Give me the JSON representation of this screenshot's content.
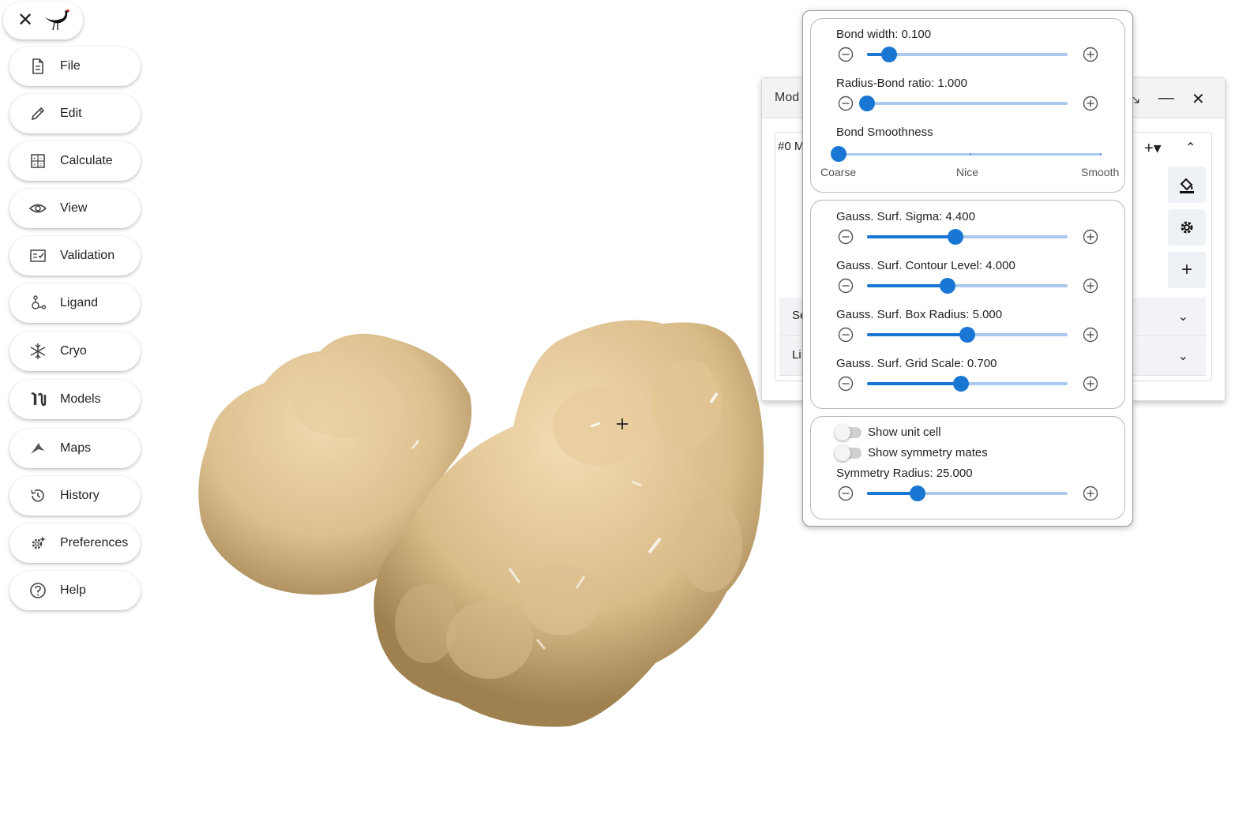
{
  "menu": [
    {
      "id": "file",
      "label": "File",
      "icon": "file-icon"
    },
    {
      "id": "edit",
      "label": "Edit",
      "icon": "pencil-icon"
    },
    {
      "id": "calculate",
      "label": "Calculate",
      "icon": "calculator-icon"
    },
    {
      "id": "view",
      "label": "View",
      "icon": "eye-icon"
    },
    {
      "id": "validation",
      "label": "Validation",
      "icon": "checklist-icon"
    },
    {
      "id": "ligand",
      "label": "Ligand",
      "icon": "molecule-icon"
    },
    {
      "id": "cryo",
      "label": "Cryo",
      "icon": "snowflake-icon"
    },
    {
      "id": "models",
      "label": "Models",
      "icon": "models-icon"
    },
    {
      "id": "maps",
      "label": "Maps",
      "icon": "map-ribbon-icon"
    },
    {
      "id": "history",
      "label": "History",
      "icon": "history-icon"
    },
    {
      "id": "preferences",
      "label": "Preferences",
      "icon": "gear-sparkle-icon"
    },
    {
      "id": "help",
      "label": "Help",
      "icon": "help-circle-icon"
    }
  ],
  "models_window": {
    "title": "Mod",
    "model_title": "#0 M",
    "accordion": [
      "Se",
      "Li"
    ]
  },
  "bond_card": {
    "bond_width": {
      "label": "Bond width: 0.100",
      "fraction": 0.11
    },
    "radius_bond": {
      "label": "Radius-Bond ratio: 1.000",
      "fraction": 0.0
    },
    "smoothness": {
      "label": "Bond Smoothness",
      "marks": [
        "Coarse",
        "Nice",
        "Smooth"
      ],
      "value_index": 0
    }
  },
  "gauss_card": [
    {
      "label": "Gauss. Surf. Sigma: 4.400",
      "fraction": 0.44
    },
    {
      "label": "Gauss. Surf. Contour Level: 4.000",
      "fraction": 0.4
    },
    {
      "label": "Gauss. Surf. Box Radius: 5.000",
      "fraction": 0.5
    },
    {
      "label": "Gauss. Surf. Grid Scale: 0.700",
      "fraction": 0.47
    }
  ],
  "symmetry_card": {
    "show_unit_cell": {
      "label": "Show unit cell",
      "on": false
    },
    "show_symmetry_mates": {
      "label": "Show symmetry mates",
      "on": false
    },
    "radius": {
      "label": "Symmetry Radius: 25.000",
      "fraction": 0.25
    }
  },
  "colors": {
    "accent": "#1976d2",
    "track_light": "#a9c9ee",
    "surface": "#e3c79a"
  }
}
